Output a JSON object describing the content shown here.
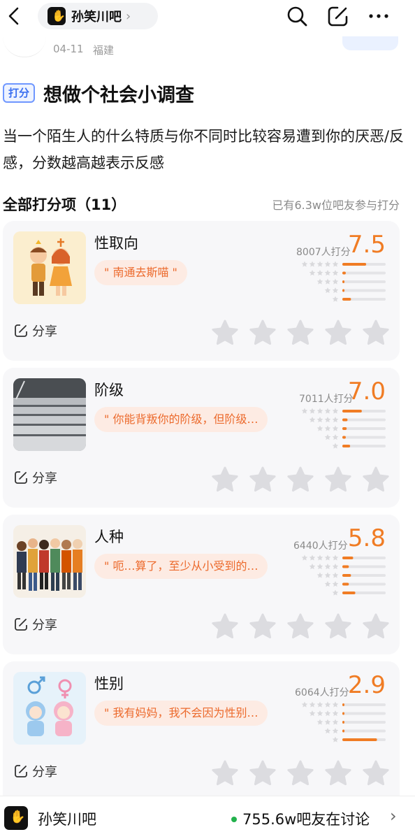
{
  "header": {
    "forum_name": "孙笑川吧",
    "icons": [
      "back-arrow-icon",
      "search-icon",
      "edit-icon",
      "more-icon"
    ]
  },
  "post_meta": {
    "date": "04-11",
    "location": "福建"
  },
  "post": {
    "tag": "打分",
    "title": "想做个社会小调查",
    "description": "当一个陌生人的什么特质与你不同时比较容易遭到你的厌恶/反感，分数越高越表示反感"
  },
  "section": {
    "title": "全部打分项（11）",
    "participants": "已有6.3w位吧友参与打分"
  },
  "items": [
    {
      "name": "性取向",
      "quote": "\" 南通去斯喵 \"",
      "raters": "8007人打分",
      "score": "7.5",
      "distribution": [
        0.55,
        0.08,
        0.05,
        0.05,
        0.2
      ],
      "share_label": "分享"
    },
    {
      "name": "阶级",
      "quote": "\" 你能背叛你的阶级，但阶级…",
      "raters": "7011人打分",
      "score": "7.0",
      "distribution": [
        0.45,
        0.12,
        0.1,
        0.08,
        0.18
      ],
      "share_label": "分享"
    },
    {
      "name": "人种",
      "quote": "\" 呃…算了，至少从小受到的…",
      "raters": "6440人打分",
      "score": "5.8",
      "distribution": [
        0.25,
        0.15,
        0.2,
        0.15,
        0.3
      ],
      "share_label": "分享"
    },
    {
      "name": "性别",
      "quote": "\" 我有妈妈，我不会因为性别…",
      "raters": "6064人打分",
      "score": "2.9",
      "distribution": [
        0.04,
        0.02,
        0.03,
        0.05,
        0.8
      ],
      "share_label": "分享"
    }
  ],
  "colors": {
    "accent": "#f07c24",
    "quote_bg": "#fdebe3",
    "tag_blue": "#3a6ff0",
    "card_bg": "#f7f7f9"
  },
  "bottom_bar": {
    "forum_name": "孙笑川吧",
    "discussion": "755.6w吧友在讨论"
  }
}
